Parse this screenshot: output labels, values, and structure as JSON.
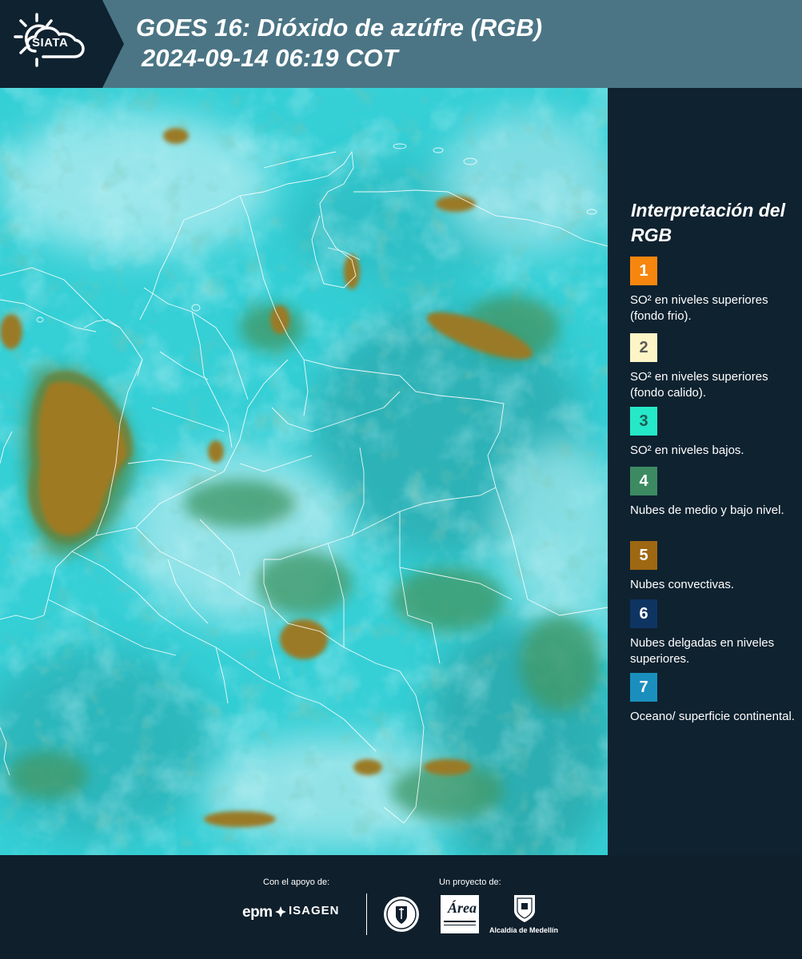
{
  "header": {
    "logo_text": "SIATA",
    "title_line1": "GOES 16: Dióxido de azúfre (RGB)",
    "title_line2": "2024-09-14 06:19 COT"
  },
  "legend": {
    "title": "Interpretación del RGB",
    "items": [
      {
        "number": "1",
        "color": "#f7860f",
        "text_color": "#ffffff",
        "label": "SO² en niveles superiores (fondo frio)."
      },
      {
        "number": "2",
        "color": "#fdf5c6",
        "text_color": "#5a5a5a",
        "label": "SO² en niveles superiores (fondo calido)."
      },
      {
        "number": "3",
        "color": "#25e8c8",
        "text_color": "#1d5c55",
        "label": "SO² en niveles bajos."
      },
      {
        "number": "4",
        "color": "#3c8a62",
        "text_color": "#ffffff",
        "label": "Nubes de medio y bajo nivel."
      },
      {
        "number": "5",
        "color": "#9e6712",
        "text_color": "#ffffff",
        "label": "Nubes convectivas."
      },
      {
        "number": "6",
        "color": "#0e3462",
        "text_color": "#ffffff",
        "label": "Nubes delgadas en niveles superiores."
      },
      {
        "number": "7",
        "color": "#1a8fbd",
        "text_color": "#ffffff",
        "label": "Oceano/ superficie continental."
      }
    ]
  },
  "footer": {
    "support_label": "Con el apoyo de:",
    "project_label": "Un proyecto de:",
    "sponsors": [
      "epm",
      "ISAGEN"
    ],
    "partners": [
      "Área Metropolitana",
      "Alcaldía de Medellín"
    ],
    "alcaldia_label": "Alcaldía de Medellín",
    "area_label": "Área"
  },
  "map": {
    "colors": {
      "background": "#35cfd6",
      "cloud": "#9ee6ea",
      "green": "#3f9a6a",
      "convective": "#9a7a25"
    }
  }
}
